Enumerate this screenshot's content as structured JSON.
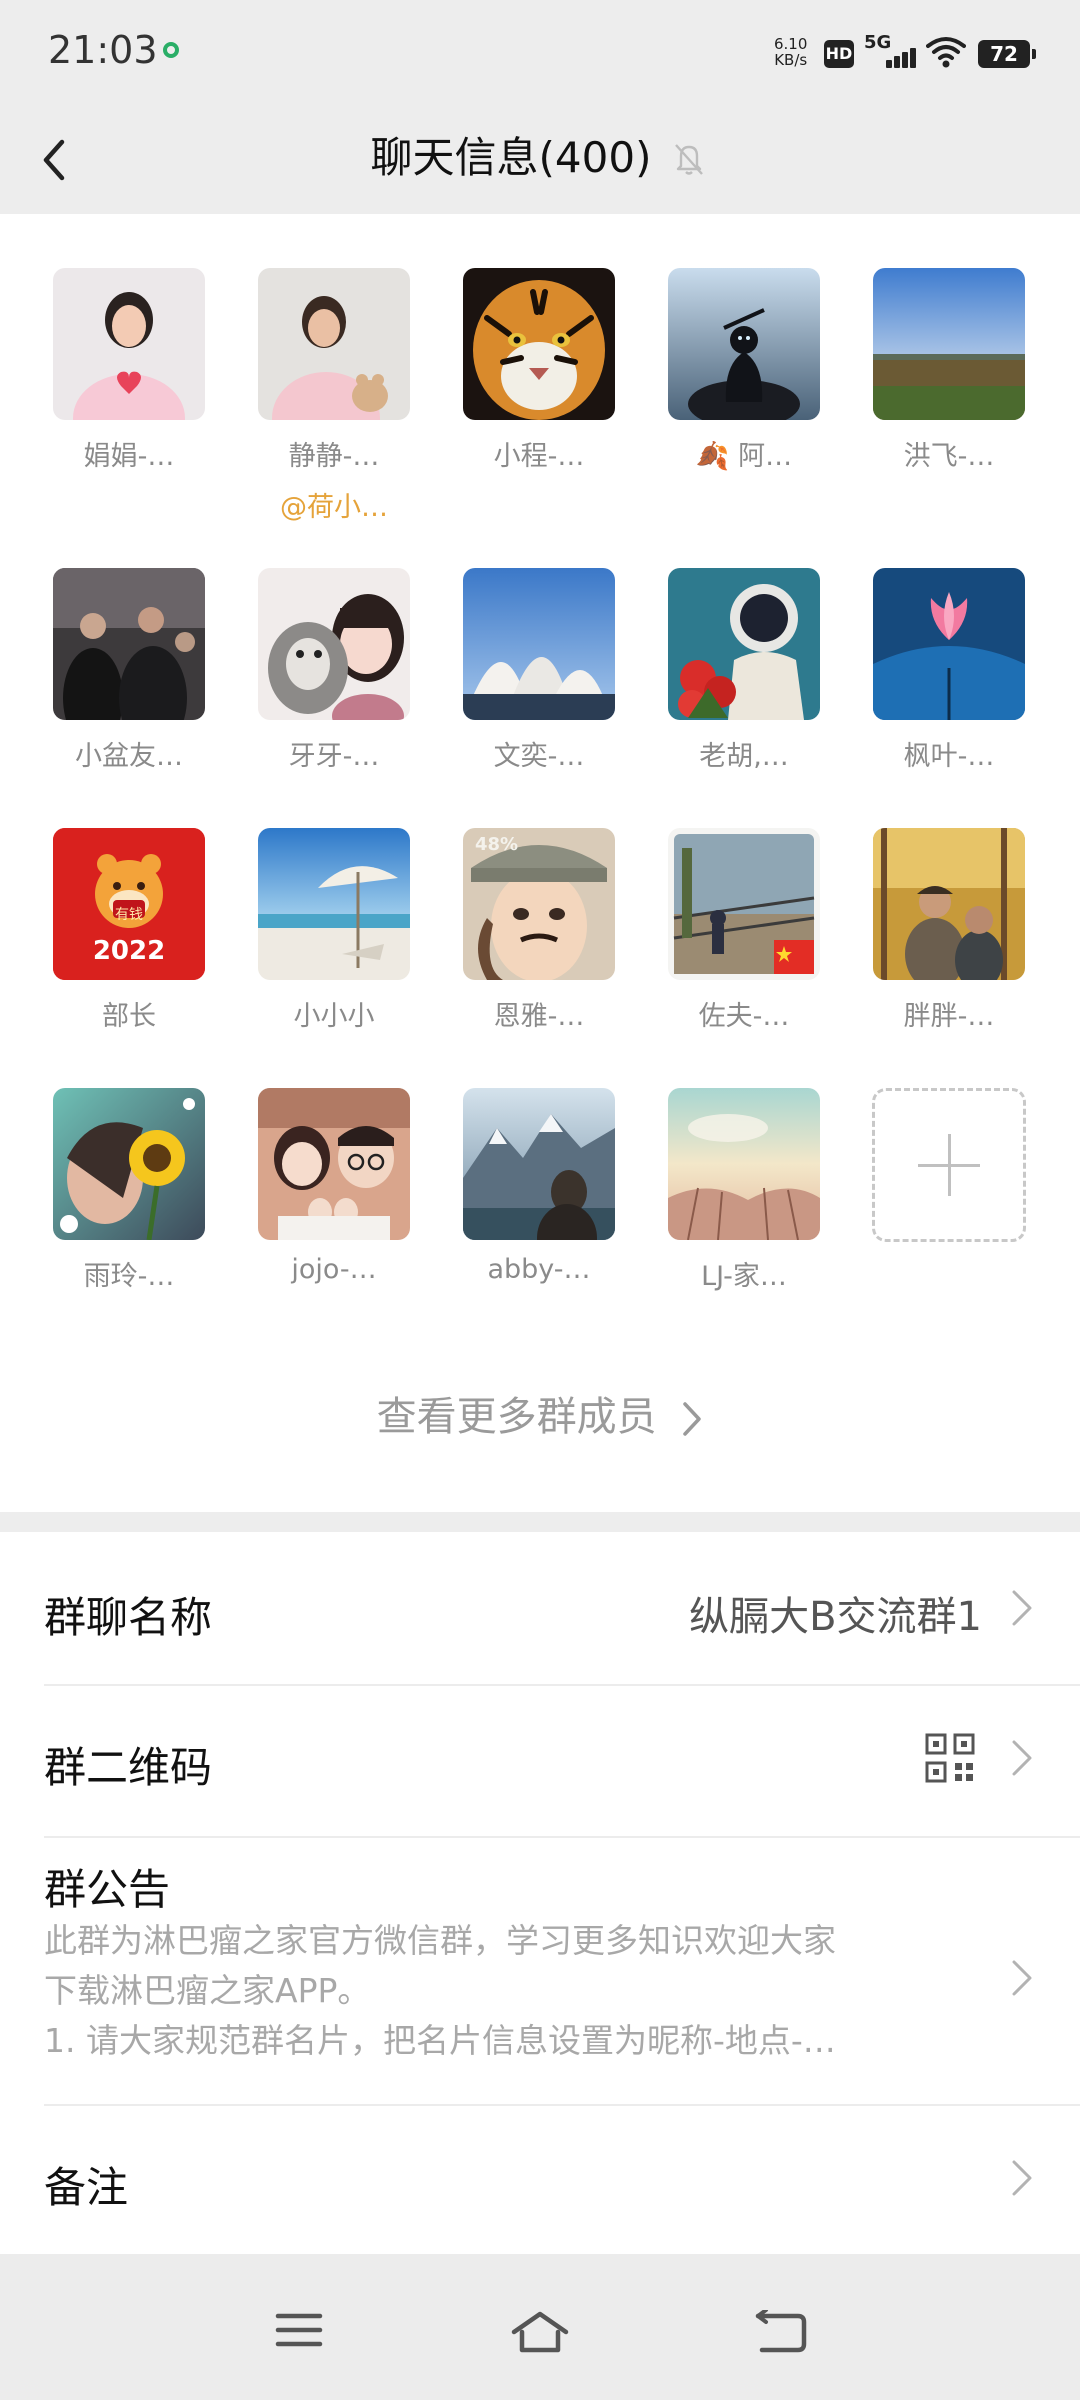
{
  "status_bar": {
    "time": "21:03",
    "net_speed_value": "6.10",
    "net_speed_unit": "KB/s",
    "hd": "HD",
    "network": "5G",
    "battery": "72"
  },
  "nav": {
    "title": "聊天信息(400)"
  },
  "members": [
    {
      "name": "娟娟-…",
      "nick": ""
    },
    {
      "name": "静静-…",
      "nick": "@荷小…"
    },
    {
      "name": "小程-…",
      "nick": ""
    },
    {
      "name": "🍂 阿…",
      "nick": ""
    },
    {
      "name": "洪飞-…",
      "nick": ""
    },
    {
      "name": "小盆友…",
      "nick": ""
    },
    {
      "name": "牙牙-…",
      "nick": ""
    },
    {
      "name": "文奕-…",
      "nick": ""
    },
    {
      "name": "老胡,…",
      "nick": ""
    },
    {
      "name": "枫叶-…",
      "nick": ""
    },
    {
      "name": "部长",
      "nick": ""
    },
    {
      "name": "小小小",
      "nick": ""
    },
    {
      "name": "恩雅-…",
      "nick": ""
    },
    {
      "name": "佐夫-…",
      "nick": ""
    },
    {
      "name": "胖胖-…",
      "nick": ""
    },
    {
      "name": "雨玲-…",
      "nick": ""
    },
    {
      "name": "jojo-…",
      "nick": ""
    },
    {
      "name": "abby-…",
      "nick": ""
    },
    {
      "name": "LJ-家…",
      "nick": ""
    }
  ],
  "avatar_texts": {
    "tiger_year": "2022",
    "tiger_badge": "有钱",
    "cap_text": "48%"
  },
  "more_members": "查看更多群成员",
  "settings": {
    "group_name_label": "群聊名称",
    "group_name_value": "纵膈大B交流群1",
    "qr_label": "群二维码",
    "notice_label": "群公告",
    "notice_line1": "此群为淋巴瘤之家官方微信群，学习更多知识欢迎大家",
    "notice_line2": "下载淋巴瘤之家APP。",
    "notice_line3": "1. 请大家规范群名片，把名片信息设置为昵称-地点-…",
    "remark_label": "备注"
  },
  "colors": {
    "background": "#ededed",
    "nickname": "#e5a33a",
    "secondary_text": "#8a8a8a"
  }
}
